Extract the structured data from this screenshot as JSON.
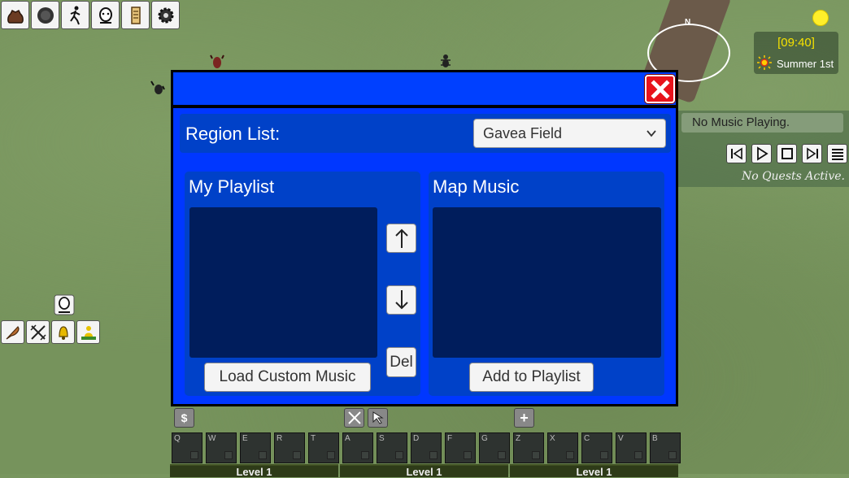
{
  "top_toolbar": {
    "icons": [
      "bag-icon",
      "boulder-icon",
      "running-person-icon",
      "face-icon",
      "scroll-icon",
      "settings-gear-icon"
    ]
  },
  "hud": {
    "compass_label": "N",
    "clock": {
      "time": "[09:40]",
      "season": "Summer 1st"
    },
    "music": {
      "now_playing": "No Music Playing.",
      "controls": [
        "previous-icon",
        "play-icon",
        "stop-icon",
        "next-icon",
        "list-icon"
      ]
    },
    "quests": "No Quests Active."
  },
  "skill_icons": [
    "feather-icon",
    "crossed-swords-icon",
    "bell-icon",
    "person-on-grass-icon"
  ],
  "dialog": {
    "region_label": "Region List:",
    "region_selected": "Gavea Field",
    "my_playlist_title": "My Playlist",
    "map_music_title": "Map Music",
    "move_up_label": "↑",
    "move_down_label": "↓",
    "delete_label": "Del",
    "load_custom_label": "Load Custom Music",
    "add_to_playlist_label": "Add to Playlist",
    "colors": {
      "frame": "#0037ff",
      "panel": "#0041c8",
      "list": "#001d5c",
      "close": "#e8141c"
    }
  },
  "hotbar": {
    "keys": [
      "Q",
      "W",
      "E",
      "R",
      "T",
      "A",
      "S",
      "D",
      "F",
      "G",
      "Z",
      "X",
      "C",
      "V",
      "B"
    ],
    "money_label": "$",
    "plus_label": "+",
    "levels": [
      "Level 1",
      "Level 1",
      "Level 1"
    ]
  }
}
